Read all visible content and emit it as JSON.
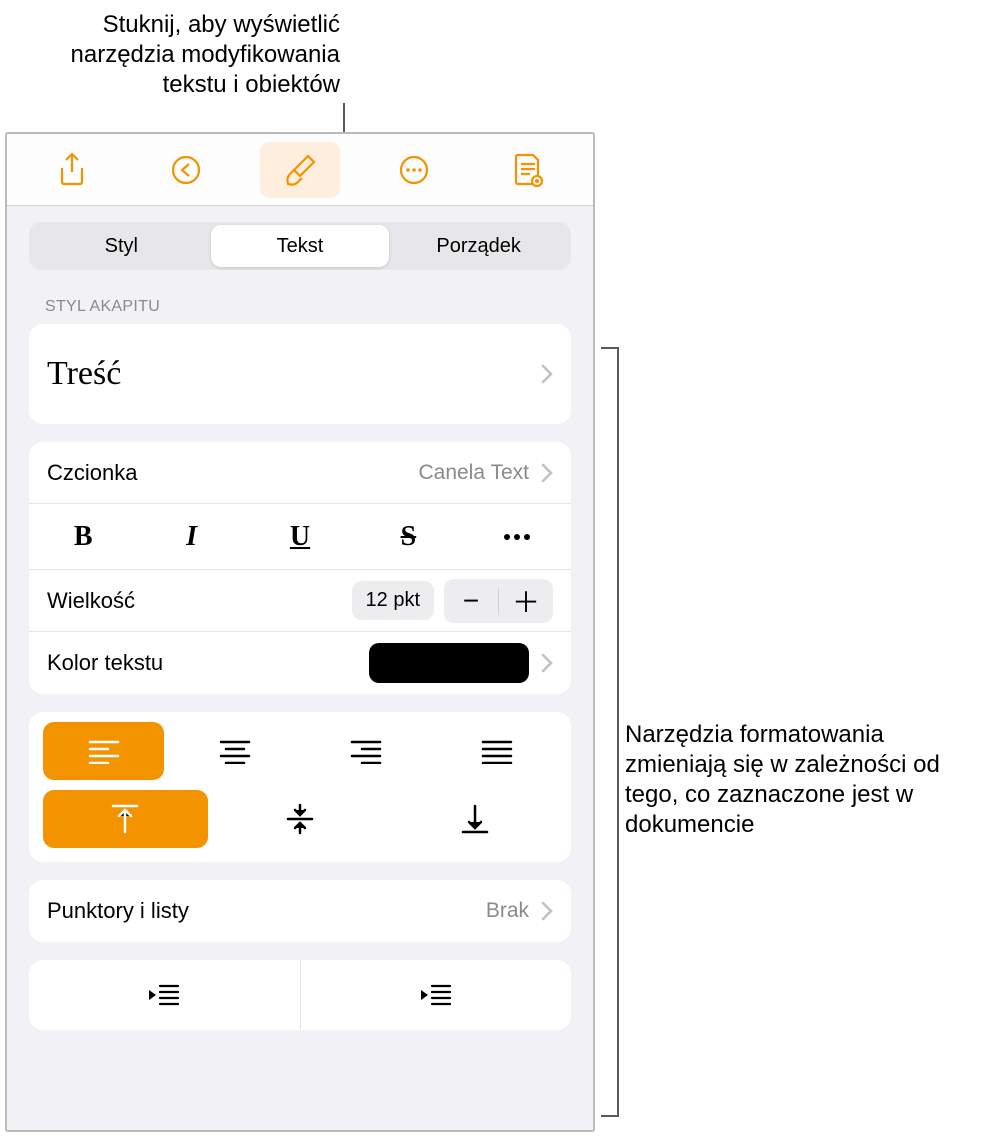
{
  "callouts": {
    "top": "Stuknij, aby wyświetlić narzędzia modyfikowania tekstu i obiektów",
    "right": "Narzędzia formatowania zmieniają się w zależności od tego, co zaznaczone jest w dokumencie"
  },
  "toolbar": {
    "share": "share",
    "undo": "undo",
    "format": "format-paintbrush",
    "more": "more",
    "view": "document-view"
  },
  "tabs": {
    "styl": "Styl",
    "tekst": "Tekst",
    "porzadek": "Porządek"
  },
  "sections": {
    "paragraph_header": "STYL AKAPITU",
    "paragraph_style": "Treść",
    "font_label": "Czcionka",
    "font_value": "Canela Text",
    "size_label": "Wielkość",
    "size_value": "12 pkt",
    "textcolor_label": "Kolor tekstu",
    "bullets_label": "Punktory i listy",
    "bullets_value": "Brak"
  },
  "font_style": {
    "bold": "B",
    "italic": "I",
    "underline": "U",
    "strike": "S"
  },
  "stepper": {
    "minus": "−",
    "plus": "＋"
  }
}
